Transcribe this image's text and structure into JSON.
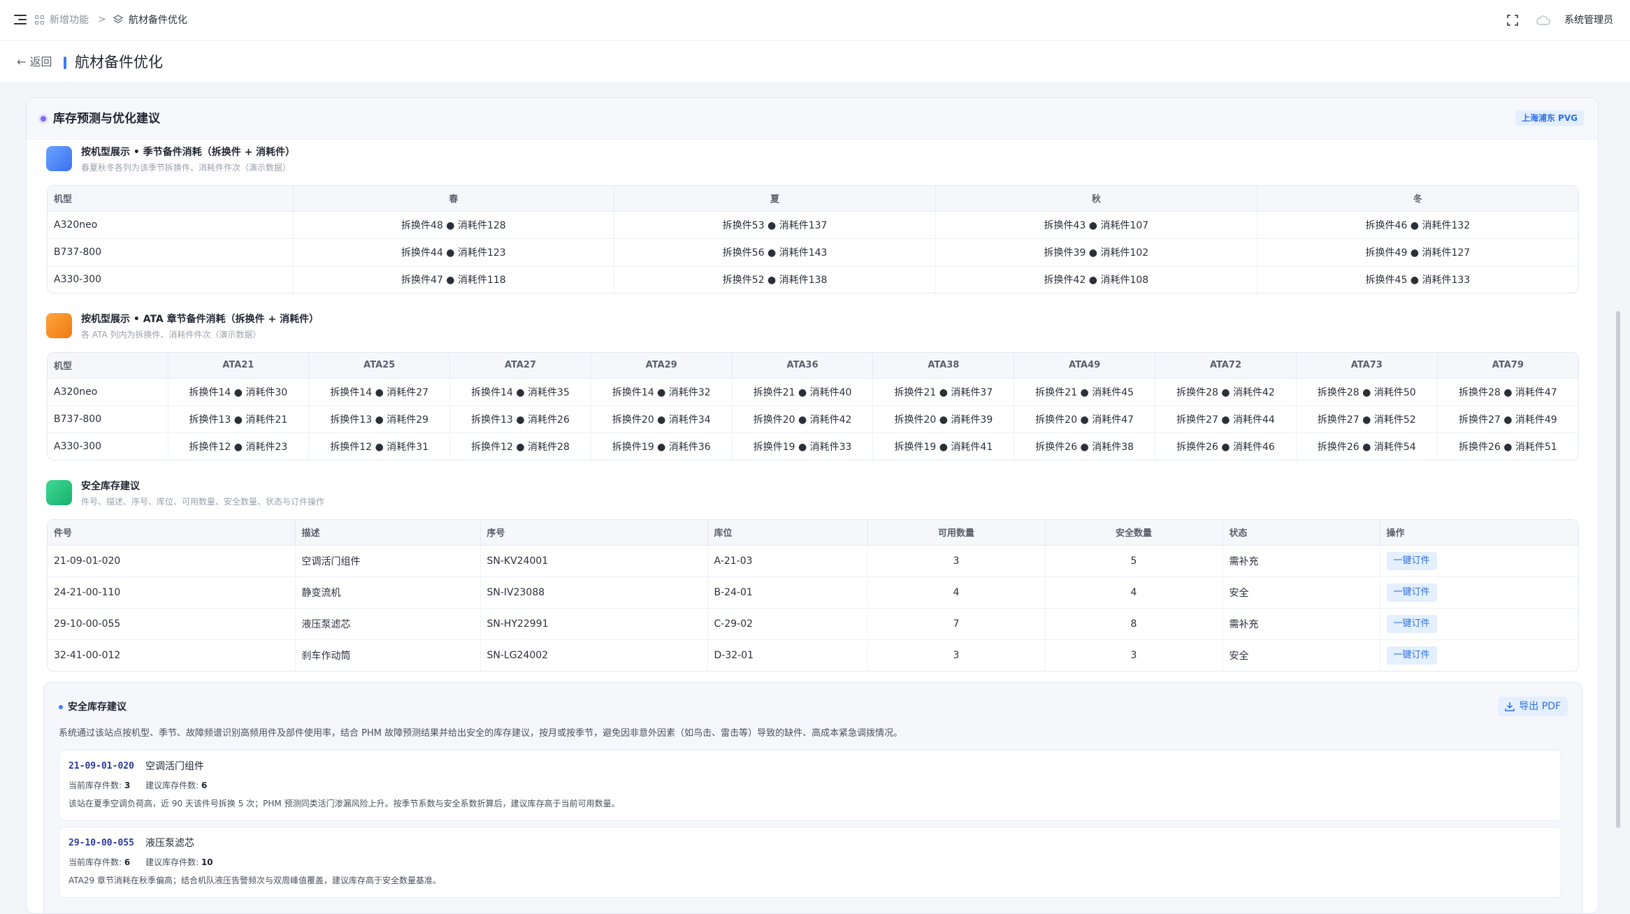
{
  "topbar": {
    "breadcrumb_parent": "新增功能",
    "breadcrumb_separator": ">",
    "breadcrumb_current": "航材备件优化",
    "user": "系统管理员"
  },
  "header": {
    "back_label": "← 返回",
    "title": "航材备件优化"
  },
  "card": {
    "title": "库存预测与优化建议",
    "location_badge": "上海浦东 PVG"
  },
  "season": {
    "title": "按机型展示 • 季节备件消耗（拆换件 + 消耗件）",
    "subtitle": "春夏秋冬各列为该季节拆换件、消耗件件次（演示数据）",
    "columns": [
      "机型",
      "春",
      "夏",
      "秋",
      "冬"
    ],
    "rows": [
      [
        "A320neo",
        "拆换件48 ● 消耗件128",
        "拆换件53 ● 消耗件137",
        "拆换件43 ● 消耗件107",
        "拆换件46 ● 消耗件132"
      ],
      [
        "B737-800",
        "拆换件44 ● 消耗件123",
        "拆换件56 ● 消耗件143",
        "拆换件39 ● 消耗件102",
        "拆换件49 ● 消耗件127"
      ],
      [
        "A330-300",
        "拆换件47 ● 消耗件118",
        "拆换件52 ● 消耗件138",
        "拆换件42 ● 消耗件108",
        "拆换件45 ● 消耗件133"
      ]
    ]
  },
  "ata": {
    "title": "按机型展示 • ATA 章节备件消耗（拆换件 + 消耗件）",
    "subtitle": "各 ATA 列内为拆换件、消耗件件次（演示数据）",
    "columns": [
      "机型",
      "ATA21",
      "ATA25",
      "ATA27",
      "ATA29",
      "ATA36",
      "ATA38",
      "ATA49",
      "ATA72",
      "ATA73",
      "ATA79"
    ],
    "rows": [
      [
        "A320neo",
        "拆换件14 ● 消耗件30",
        "拆换件14 ● 消耗件27",
        "拆换件14 ● 消耗件35",
        "拆换件14 ● 消耗件32",
        "拆换件21 ● 消耗件40",
        "拆换件21 ● 消耗件37",
        "拆换件21 ● 消耗件45",
        "拆换件28 ● 消耗件42",
        "拆换件28 ● 消耗件50",
        "拆换件28 ● 消耗件47"
      ],
      [
        "B737-800",
        "拆换件13 ● 消耗件21",
        "拆换件13 ● 消耗件29",
        "拆换件13 ● 消耗件26",
        "拆换件20 ● 消耗件34",
        "拆换件20 ● 消耗件42",
        "拆换件20 ● 消耗件39",
        "拆换件20 ● 消耗件47",
        "拆换件27 ● 消耗件44",
        "拆换件27 ● 消耗件52",
        "拆换件27 ● 消耗件49"
      ],
      [
        "A330-300",
        "拆换件12 ● 消耗件23",
        "拆换件12 ● 消耗件31",
        "拆换件12 ● 消耗件28",
        "拆换件19 ● 消耗件36",
        "拆换件19 ● 消耗件33",
        "拆换件19 ● 消耗件41",
        "拆换件26 ● 消耗件38",
        "拆换件26 ● 消耗件46",
        "拆换件26 ● 消耗件54",
        "拆换件26 ● 消耗件51"
      ]
    ]
  },
  "safety": {
    "title": "安全库存建议",
    "subtitle": "件号、描述、序号、库位、可用数量、安全数量、状态与订件操作",
    "columns": [
      "件号",
      "描述",
      "序号",
      "库位",
      "可用数量",
      "安全数量",
      "状态",
      "操作"
    ],
    "rows": [
      [
        "21-09-01-020",
        "空调活门组件",
        "SN-KV24001",
        "A-21-03",
        "3",
        "5",
        "需补充"
      ],
      [
        "24-21-00-110",
        "静变流机",
        "SN-IV23088",
        "B-24-01",
        "4",
        "4",
        "安全"
      ],
      [
        "29-10-00-055",
        "液压泵滤芯",
        "SN-HY22991",
        "C-29-02",
        "7",
        "8",
        "需补充"
      ],
      [
        "32-41-00-012",
        "刹车作动筒",
        "SN-LG24002",
        "D-32-01",
        "3",
        "3",
        "安全"
      ]
    ],
    "action_label": "一键订件"
  },
  "suggestions": {
    "title": "安全库存建议",
    "export_label": "导出 PDF",
    "description": "系统通过该站点按机型、季节、故障频谱识别高频用件及部件使用率，结合 PHM 故障预测结果并给出安全的库存建议，按月或按季节，避免因非意外因素（如鸟击、雷击等）导致的缺件、高成本紧急调拨情况。",
    "current_label": "当前库存件数:",
    "suggest_label": "建议库存件数:",
    "items": [
      {
        "code": "21-09-01-020",
        "name": "空调活门组件",
        "current": "3",
        "suggested": "6",
        "note": "该站在夏季空调负荷高，近 90 天该件号拆换 5 次；PHM 预测同类活门渗漏风险上升。按季节系数与安全系数折算后，建议库存高于当前可用数量。"
      },
      {
        "code": "29-10-00-055",
        "name": "液压泵滤芯",
        "current": "6",
        "suggested": "10",
        "note": "ATA29 章节消耗在秋季偏高；结合机队液压告警频次与双周峰值覆盖，建议库存高于安全数量基准。"
      }
    ]
  },
  "colors": {
    "accent": "#3b7cf5",
    "season_icon": "#4a8cf7",
    "ata_icon": "#f5891f",
    "safety_icon": "#22c07a",
    "badge_bg": "#e3efff"
  }
}
